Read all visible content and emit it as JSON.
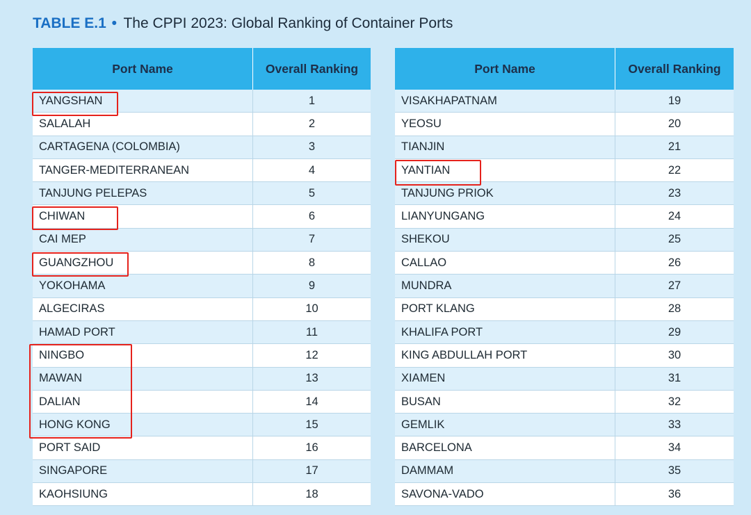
{
  "title": {
    "code": "TABLE E.1",
    "bullet": "•",
    "text": "The CPPI 2023: Global Ranking of Container Ports"
  },
  "columns": {
    "name": "Port Name",
    "rank": "Overall Ranking"
  },
  "left_rows": [
    {
      "name": "YANGSHAN",
      "rank": "1"
    },
    {
      "name": "SALALAH",
      "rank": "2"
    },
    {
      "name": "CARTAGENA (COLOMBIA)",
      "rank": "3"
    },
    {
      "name": "TANGER-MEDITERRANEAN",
      "rank": "4"
    },
    {
      "name": "TANJUNG PELEPAS",
      "rank": "5"
    },
    {
      "name": "CHIWAN",
      "rank": "6"
    },
    {
      "name": "CAI MEP",
      "rank": "7"
    },
    {
      "name": "GUANGZHOU",
      "rank": "8"
    },
    {
      "name": "YOKOHAMA",
      "rank": "9"
    },
    {
      "name": "ALGECIRAS",
      "rank": "10"
    },
    {
      "name": "HAMAD PORT",
      "rank": "11"
    },
    {
      "name": "NINGBO",
      "rank": "12"
    },
    {
      "name": "MAWAN",
      "rank": "13"
    },
    {
      "name": "DALIAN",
      "rank": "14"
    },
    {
      "name": "HONG KONG",
      "rank": "15"
    },
    {
      "name": "PORT SAID",
      "rank": "16"
    },
    {
      "name": "SINGAPORE",
      "rank": "17"
    },
    {
      "name": "KAOHSIUNG",
      "rank": "18"
    }
  ],
  "right_rows": [
    {
      "name": "VISAKHAPATNAM",
      "rank": "19"
    },
    {
      "name": "YEOSU",
      "rank": "20"
    },
    {
      "name": "TIANJIN",
      "rank": "21"
    },
    {
      "name": "YANTIAN",
      "rank": "22"
    },
    {
      "name": "TANJUNG PRIOK",
      "rank": "23"
    },
    {
      "name": "LIANYUNGANG",
      "rank": "24"
    },
    {
      "name": "SHEKOU",
      "rank": "25"
    },
    {
      "name": "CALLAO",
      "rank": "26"
    },
    {
      "name": "MUNDRA",
      "rank": "27"
    },
    {
      "name": "PORT KLANG",
      "rank": "28"
    },
    {
      "name": "KHALIFA PORT",
      "rank": "29"
    },
    {
      "name": "KING ABDULLAH PORT",
      "rank": "30"
    },
    {
      "name": "XIAMEN",
      "rank": "31"
    },
    {
      "name": "BUSAN",
      "rank": "32"
    },
    {
      "name": "GEMLIK",
      "rank": "33"
    },
    {
      "name": "BARCELONA",
      "rank": "34"
    },
    {
      "name": "DAMMAM",
      "rank": "35"
    },
    {
      "name": "SAVONA-VADO",
      "rank": "36"
    }
  ],
  "colors": {
    "header": "#2eb1ea",
    "row_alt": "#ddf0fb",
    "highlight": "#e5221c",
    "title_accent": "#1a6fc4"
  }
}
